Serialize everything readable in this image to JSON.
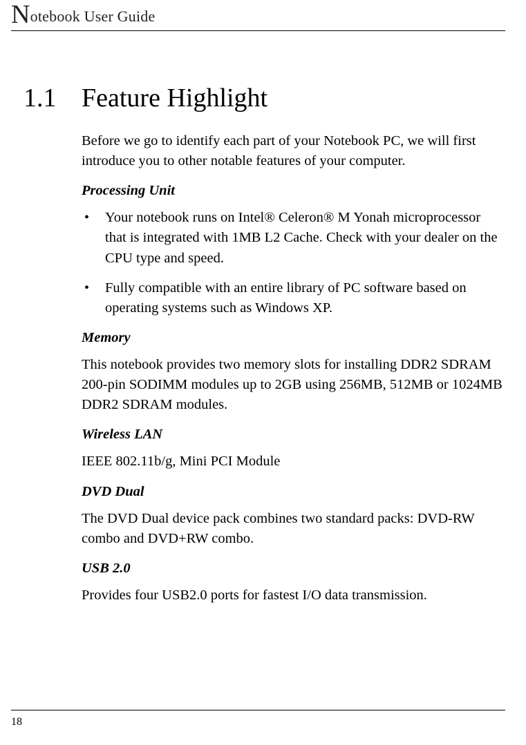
{
  "header": {
    "title_dropcap": "N",
    "title_rest": "otebook User Guide"
  },
  "section": {
    "number": "1.1",
    "title": "Feature Highlight",
    "intro": "Before we go to identify each part of your Notebook PC, we will first introduce you to other notable features of your computer.",
    "processing_unit": {
      "heading": "Processing Unit",
      "bullets": [
        "Your notebook runs on Intel® Celeron® M Yonah microprocessor that is integrated with 1MB L2 Cache. Check with your dealer on the CPU type and speed.",
        "Fully compatible with an entire library of PC software based on operating systems such as Windows XP."
      ]
    },
    "memory": {
      "heading": "Memory",
      "text": "This notebook provides two memory slots for installing DDR2 SDRAM 200-pin SODIMM modules up to 2GB using 256MB, 512MB or 1024MB DDR2 SDRAM modules."
    },
    "wireless_lan": {
      "heading": "Wireless LAN",
      "text": "IEEE 802.11b/g, Mini PCI Module"
    },
    "dvd_dual": {
      "heading": "DVD Dual",
      "text": "The DVD Dual device pack combines two standard packs: DVD-RW combo and DVD+RW combo."
    },
    "usb": {
      "heading": "USB 2.0",
      "text": "Provides four USB2.0 ports for fastest I/O data transmission."
    }
  },
  "footer": {
    "page_number": "18"
  }
}
